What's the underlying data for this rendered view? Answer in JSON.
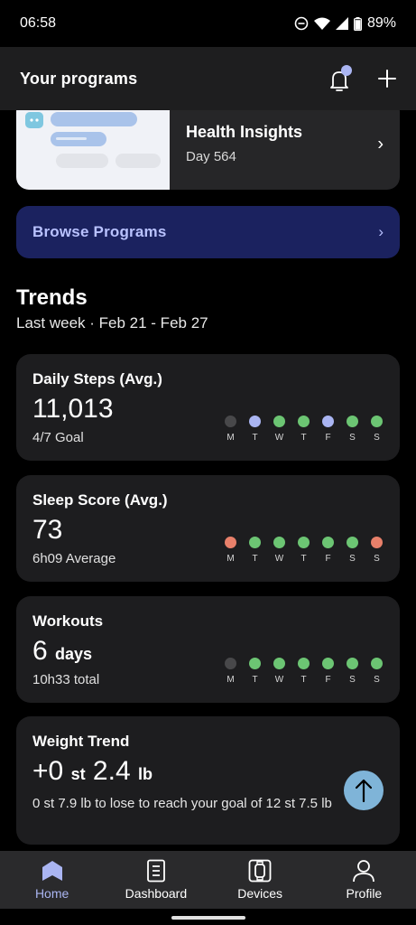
{
  "status_bar": {
    "time": "06:58",
    "battery": "89%"
  },
  "header": {
    "title": "Your programs"
  },
  "program": {
    "title": "Health Insights",
    "subtitle": "Day 564"
  },
  "browse": {
    "label": "Browse Programs"
  },
  "trends": {
    "title": "Trends",
    "period": "Last week · Feb 21 - Feb 27"
  },
  "colors": {
    "green": "#6cc573",
    "lavender": "#aab5f2",
    "grey": "#48484a",
    "salmon": "#e8806a",
    "browse_bg": "#1b225f",
    "fab": "#7fb4d8"
  },
  "cards": {
    "steps": {
      "title": "Daily Steps (Avg.)",
      "value": "11,013",
      "subtitle": "4/7 Goal",
      "days": [
        {
          "label": "M",
          "status": "none"
        },
        {
          "label": "T",
          "status": "partial"
        },
        {
          "label": "W",
          "status": "good"
        },
        {
          "label": "T",
          "status": "good"
        },
        {
          "label": "F",
          "status": "partial"
        },
        {
          "label": "S",
          "status": "good"
        },
        {
          "label": "S",
          "status": "good"
        }
      ]
    },
    "sleep": {
      "title": "Sleep Score (Avg.)",
      "value": "73",
      "subtitle": "6h09 Average",
      "days": [
        {
          "label": "M",
          "status": "bad"
        },
        {
          "label": "T",
          "status": "good"
        },
        {
          "label": "W",
          "status": "good"
        },
        {
          "label": "T",
          "status": "good"
        },
        {
          "label": "F",
          "status": "good"
        },
        {
          "label": "S",
          "status": "good"
        },
        {
          "label": "S",
          "status": "bad"
        }
      ]
    },
    "workouts": {
      "title": "Workouts",
      "value": "6",
      "unit": "days",
      "subtitle": "10h33 total",
      "days": [
        {
          "label": "M",
          "status": "none"
        },
        {
          "label": "T",
          "status": "good"
        },
        {
          "label": "W",
          "status": "good"
        },
        {
          "label": "T",
          "status": "good"
        },
        {
          "label": "F",
          "status": "good"
        },
        {
          "label": "S",
          "status": "good"
        },
        {
          "label": "S",
          "status": "good"
        }
      ]
    },
    "weight": {
      "title": "Weight Trend",
      "value_prefix": "+0",
      "unit1": "st",
      "value2": "2.4",
      "unit2": "lb",
      "subtitle": "0 st 7.9 lb to lose to reach your goal of 12 st 7.5 lb"
    }
  },
  "nav": [
    {
      "label": "Home",
      "icon": "home-icon",
      "active": true
    },
    {
      "label": "Dashboard",
      "icon": "dashboard-icon",
      "active": false
    },
    {
      "label": "Devices",
      "icon": "watch-icon",
      "active": false
    },
    {
      "label": "Profile",
      "icon": "profile-icon",
      "active": false
    }
  ]
}
